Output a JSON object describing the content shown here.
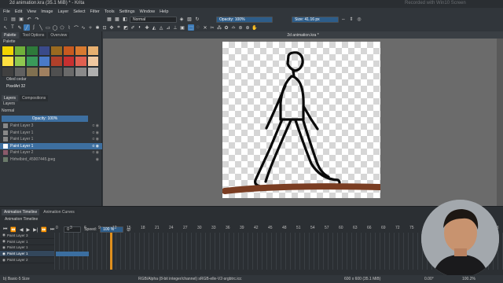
{
  "window": {
    "title": "2d animation.kra (35.1 MiB) * - Krita",
    "watermark": "Recorded with Win10 Screen"
  },
  "menu": [
    "File",
    "Edit",
    "View",
    "Image",
    "Layer",
    "Select",
    "Filter",
    "Tools",
    "Settings",
    "Window",
    "Help"
  ],
  "toolbar": {
    "blend_mode": "Normal",
    "opacity": "Opacity: 100%",
    "size": "Size: 41.16 px"
  },
  "left_dock": {
    "tabs": [
      "Palette",
      "Tool Options",
      "Overview"
    ],
    "palette_name": "Palette",
    "palette_colors": [
      "#f2d300",
      "#70b03a",
      "#2e7a3a",
      "#3a4a8a",
      "#9a6a20",
      "#c85a20",
      "#d87a30",
      "#e8b070",
      "#ffe040",
      "#90c850",
      "#3a9a5a",
      "#4a7ac8",
      "#b0402a",
      "#c83030",
      "#e06050",
      "#f0c8a0",
      "#404040",
      "#606060",
      "#807050",
      "#a08060",
      "#505050",
      "#6a6a6a",
      "#8a8a8a",
      "#b0b0b0"
    ],
    "oiled_cedar": "Oiled cedar",
    "pixelart": "PixelArt 32",
    "layers_tabs": [
      "Layers",
      "Compositions"
    ],
    "layers_title": "Layers",
    "blend": "Normal",
    "opacity": "Opacity:  100%",
    "layers": [
      {
        "name": "Paint Layer 3",
        "selected": false
      },
      {
        "name": "Paint Layer 1",
        "selected": false
      },
      {
        "name": "Paint Layer 1",
        "selected": false
      },
      {
        "name": "Paint Layer 1",
        "selected": true
      },
      {
        "name": "Paint Layer 2",
        "selected": false
      },
      {
        "name": "Hirhelbird_45907445.jpeg",
        "selected": false
      }
    ]
  },
  "canvas": {
    "doc_tab": "2d animation.kra *",
    "stroke_color": "#0a0a0a",
    "ground_color": "#7a3d22"
  },
  "timeline": {
    "tabs": [
      "Animation Timeline",
      "Animation Curves"
    ],
    "header": "Animation Timeline",
    "current_frame": "0",
    "speed_label": "Speed:",
    "speed_value": "100 %",
    "ticks": [
      "0",
      "3",
      "6",
      "9",
      "12",
      "15",
      "18",
      "21",
      "24",
      "27",
      "30",
      "33",
      "36",
      "39",
      "42",
      "45",
      "48",
      "51",
      "54",
      "57",
      "60",
      "63",
      "66",
      "69",
      "72",
      "75",
      "78",
      "81",
      "84",
      "87",
      "90",
      "93"
    ],
    "layers": [
      "Paint Layer 3",
      "Paint Layer 1",
      "Paint Layer 1",
      "Paint Layer 1",
      "Paint Layer 2"
    ]
  },
  "status": {
    "brush": "b) Basic-5 Size",
    "color_space": "RGB/Alpha (8-bit integer/channel)  sRGB-elle-V2-srgbtrc.icc",
    "dims": "600 x 600 (35.1 MiB)",
    "angle": "0.00°",
    "zoom": "100.2%"
  }
}
